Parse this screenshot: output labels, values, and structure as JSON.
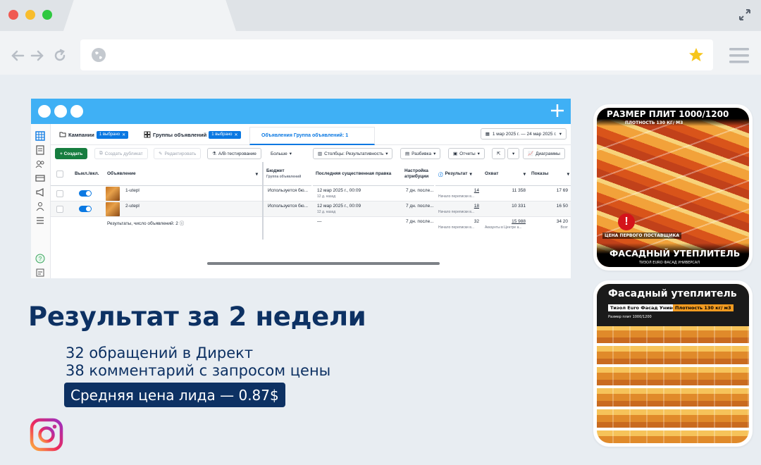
{
  "app": {
    "tabs": {
      "campaigns": "Кампании",
      "campaigns_badge": "1 выбрано",
      "adsets": "Группы объявлений",
      "adsets_badge": "1 выбрано",
      "ads": "Объявления Группа объявлений: 1"
    },
    "date_range": "1 мар 2025 г. — 24 мар 2025 г.",
    "toolbar": {
      "create": "+ Создать",
      "duplicate": "Создать дубликат",
      "edit": "Редактировать",
      "ab_test": "A/B-тестирование",
      "more": "Больше",
      "columns": "Столбцы: Результативность",
      "breakdown": "Разбивка",
      "reports": "Отчеты",
      "charts": "Диаграммы"
    },
    "columns": {
      "toggle": "Выкл./вкл.",
      "ad": "Объявление",
      "budget": "Бюджет",
      "budget_sub": "Группа объявлений",
      "last_edit": "Последняя существенная правка",
      "attribution": "Настройка атрибуции",
      "results": "Результат",
      "reach": "Охват",
      "impressions": "Показы"
    },
    "rows": [
      {
        "name": "1-utepl",
        "budget": "Используется бю...",
        "edit": "12 мар 2025 г., 00:09",
        "edit_sub": "12 д. назад",
        "attribution": "7 дн. после...",
        "results": "14",
        "results_sub": "Начало переписки в...",
        "reach": "11 358",
        "impressions": "17 69"
      },
      {
        "name": "2-utepl",
        "budget": "Используется бю...",
        "edit": "12 мар 2025 г., 00:09",
        "edit_sub": "12 д. назад",
        "attribution": "7 дн. после...",
        "results": "18",
        "results_sub": "Начало переписки в...",
        "reach": "10 331",
        "impressions": "16 50"
      }
    ],
    "summary": {
      "label": "Результаты, число объявлений: 2",
      "edit": "—",
      "attribution": "7 дн. после...",
      "results": "32",
      "results_sub": "Начало переписки в...",
      "reach": "15 988",
      "reach_sub": "Аккаунты в Центре а...",
      "impressions": "34 20",
      "impressions_sub": "Всег"
    }
  },
  "headline": "Результат за 2 недели",
  "stats": {
    "line1": "32 обращений в Директ",
    "line2": "38 комментарий с запросом цены",
    "price": "Средняя цена лида — 0.87$"
  },
  "ad1": {
    "title": "РАЗМЕР ПЛИТ 1000/1200",
    "subtitle": "ПЛОТНОСТЬ 130 КГ/ М3",
    "alert": "ЦЕНА ПЕРВОГО ПОСТАВЩИКА",
    "footer": "ФАСАДНЫЙ УТЕПЛИТЕЛЬ",
    "footer_sub": "ТИЗОЛ EURO ФАСАД УНИВЕРСАЛ"
  },
  "ad2": {
    "title": "Фасадный утеплитель",
    "chip1": "Тизол Euro Фасад Универсал",
    "chip2": "Плотность 130 кг/ м3",
    "sub": "Размер плит 1000/1200"
  },
  "colors": {
    "navy": "#0d3163",
    "accent": "#0a78e2",
    "title_bar": "#3fb0f5",
    "create_green": "#167d3f"
  }
}
